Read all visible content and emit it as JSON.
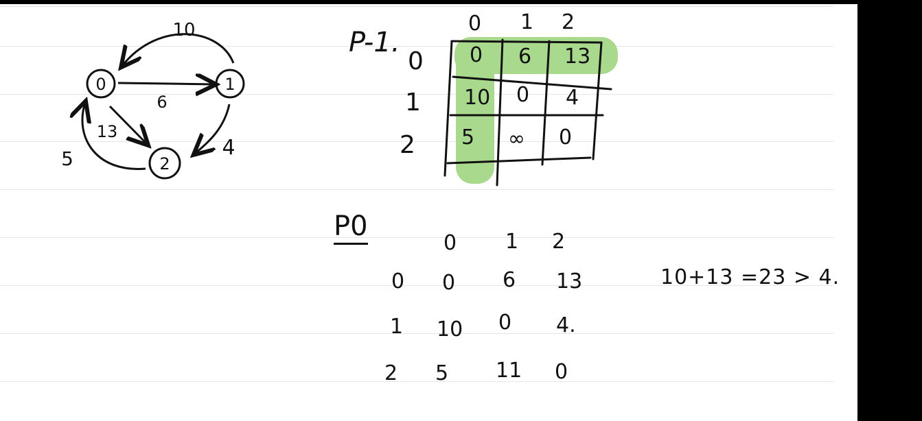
{
  "graph": {
    "nodes": [
      "0",
      "1",
      "2"
    ],
    "edges": [
      {
        "from": "0",
        "to": "1",
        "weight": "6"
      },
      {
        "from": "1",
        "to": "0",
        "weight": "10"
      },
      {
        "from": "0",
        "to": "2",
        "weight": "13"
      },
      {
        "from": "1",
        "to": "2",
        "weight": "4"
      },
      {
        "from": "2",
        "to": "0",
        "weight": "5"
      }
    ]
  },
  "p_minus1": {
    "title": "P-1.",
    "col_headers": [
      "0",
      "1",
      "2"
    ],
    "row_headers": [
      "0",
      "1",
      "2"
    ],
    "rows": [
      [
        "0",
        "6",
        "13"
      ],
      [
        "10",
        "0",
        "4"
      ],
      [
        "5",
        "∞",
        "0"
      ]
    ],
    "highlight_color": "#a9d98c"
  },
  "p0": {
    "title": "P0",
    "col_headers": [
      "0",
      "1",
      "2"
    ],
    "row_headers": [
      "0",
      "1",
      "2"
    ],
    "rows": [
      [
        "0",
        "6",
        "13"
      ],
      [
        "10",
        "0",
        "4."
      ],
      [
        "5",
        "11",
        "0"
      ]
    ]
  },
  "note": "10+13 =23 > 4."
}
